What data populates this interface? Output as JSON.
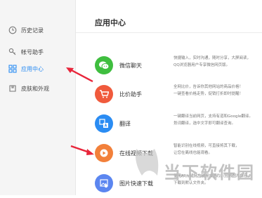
{
  "sidebar": {
    "items": [
      {
        "label": "历史记录",
        "icon": "clock-icon"
      },
      {
        "label": "帐号助手",
        "icon": "key-icon"
      },
      {
        "label": "应用中心",
        "icon": "grid-icon",
        "active": true
      },
      {
        "label": "皮肤和外观",
        "icon": "shirt-icon"
      }
    ]
  },
  "main": {
    "title": "应用中心",
    "apps": [
      {
        "name": "微信聊天",
        "icon": "wechat-icon",
        "color": "#3fbe3f",
        "desc": [
          "快捷输入，实时沟通，随时分享，大屏阅读，",
          "QQ浏览器用户专享微信网页版。"
        ]
      },
      {
        "name": "比价助手",
        "icon": "cart-icon",
        "color": "#f05a3c",
        "desc": [
          "全网比价，告诉你其他网站的商品价格！",
          "一键查看价格走势，促销打折即时提醒！"
        ]
      },
      {
        "name": "翻译",
        "icon": "translate-icon",
        "color": "#2a8cf3",
        "desc": [
          "一键翻译当前网页，支持有道和Google翻译。",
          "划词翻译，选中文字即可翻译查询。"
        ]
      },
      {
        "name": "在线视频下载",
        "icon": "video-download-icon",
        "color": "#f2803a",
        "desc": [
          "智能识别在线视频，可直接将其下载，",
          "让您在离线也能观看。"
        ]
      },
      {
        "name": "图片快速下载",
        "icon": "image-download-icon",
        "color": "#5b86f0",
        "desc": [
          "使用Alt+鼠标左键点击图片，可将图片保存，",
          "下载到默认文件夹。"
        ]
      }
    ]
  },
  "watermark": {
    "text": "当下软件园",
    "url": "www.downxia.com"
  },
  "colors": {
    "accent": "#2a8cf3",
    "arrow": "#e8253a"
  }
}
